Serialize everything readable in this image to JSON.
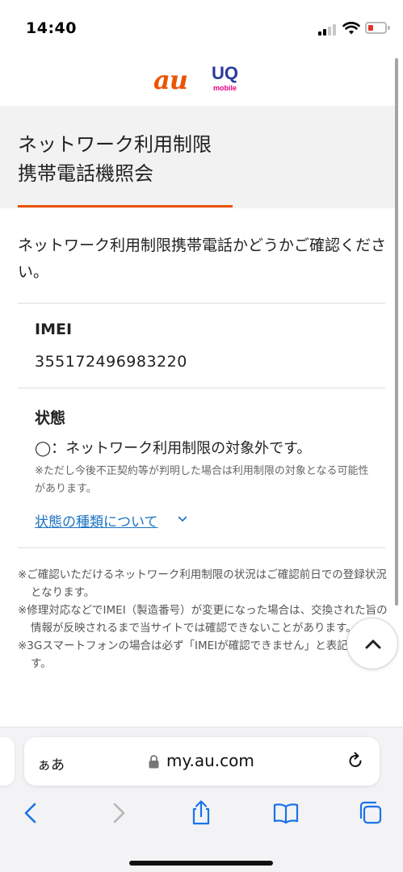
{
  "status_bar": {
    "time": "14:40"
  },
  "logos": {
    "au": "au",
    "uq": "UQ",
    "uq_sub": "mobile"
  },
  "page": {
    "title_line1": "ネットワーク利用制限",
    "title_line2": "携帯電話機照会",
    "intro": "ネットワーク利用制限携帯電話かどうかご確認ください。"
  },
  "result": {
    "imei_label": "IMEI",
    "imei_value": "355172496983220",
    "status_label": "状態",
    "status_text": "◯：ネットワーク利用制限の対象外です。",
    "status_note": "※ただし今後不正契約等が判明した場合は利用制限の対象となる可能性があります。",
    "status_link": "状態の種類について"
  },
  "notes": [
    "※ご確認いただけるネットワーク利用制限の状況はご確認前日での登録状況となります。",
    "※修理対応などでIMEI（製造番号）が変更になった場合は、交換された旨の情報が反映されるまで当サイトでは確認できないことがあります。",
    "※3Gスマートフォンの場合は必ず「IMEIが確認できません」と表記されます。"
  ],
  "browser": {
    "aa_label": "ぁあ",
    "url": "my.au.com"
  },
  "colors": {
    "accent": "#ea5504",
    "link": "#1a73c4",
    "title_band": "#f2f2f2",
    "ios_blue": "#1a73e8"
  },
  "icons": {
    "back": "chevron-left-icon",
    "forward": "chevron-right-icon",
    "share": "share-icon",
    "bookmarks": "book-icon",
    "tabs": "tabs-icon",
    "to_top": "chevron-up-icon",
    "reload": "reload-icon",
    "lock": "lock-icon"
  }
}
